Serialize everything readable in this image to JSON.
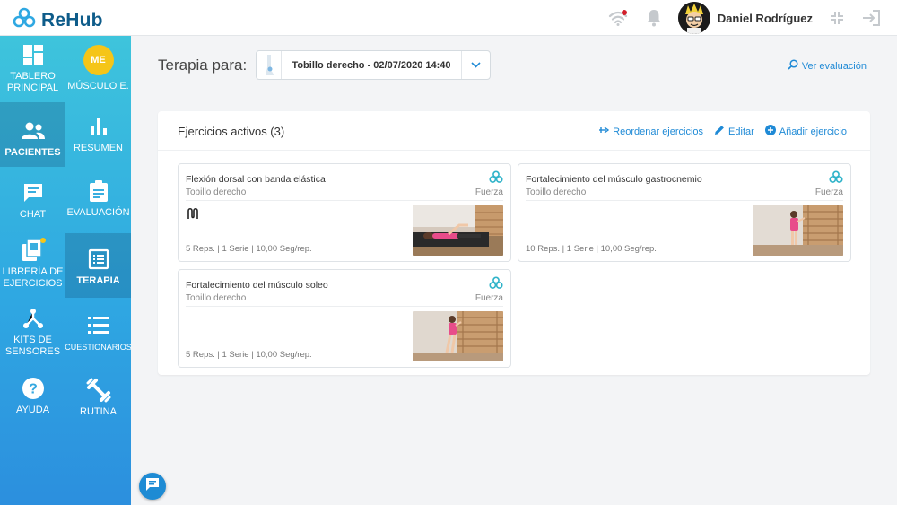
{
  "app": {
    "name": "ReHub"
  },
  "user": {
    "name": "Daniel Rodríguez"
  },
  "sidebar": {
    "col1": [
      {
        "label": "TABLERO PRINCIPAL",
        "icon": "dashboard-icon",
        "active": false
      },
      {
        "label": "PACIENTES",
        "icon": "users-icon",
        "active": true
      },
      {
        "label": "CHAT",
        "icon": "chat-icon",
        "active": false
      },
      {
        "label": "LIBRERÍA DE EJERCICIOS",
        "icon": "library-icon",
        "active": false
      },
      {
        "label": "KITS DE SENSORES",
        "icon": "sensors-icon",
        "active": false
      },
      {
        "label": "AYUDA",
        "icon": "help-icon",
        "active": false
      }
    ],
    "col2": [
      {
        "label": "MÚSCULO E.",
        "badge": "ME",
        "active": false
      },
      {
        "label": "RESUMEN",
        "icon": "bar-chart-icon",
        "active": false
      },
      {
        "label": "EVALUACIÓN",
        "icon": "clipboard-icon",
        "active": false
      },
      {
        "label": "TERAPIA",
        "icon": "list-doc-icon",
        "active": true
      },
      {
        "label": "CUESTIONARIOS",
        "icon": "checklist-icon",
        "active": false
      },
      {
        "label": "RUTINA",
        "icon": "dumbbell-icon",
        "active": false
      }
    ]
  },
  "header": {
    "label": "Terapia para:",
    "selected_therapy": "Tobillo derecho - 02/07/2020 14:40",
    "ver_evaluacion": "Ver evaluación"
  },
  "panel": {
    "title": "Ejercicios activos (3)",
    "actions": {
      "reorder": "Reordenar ejercicios",
      "edit": "Editar",
      "add": "Añadir ejercicio"
    }
  },
  "exercises": [
    {
      "title": "Flexión dorsal con banda elástica",
      "subtitle": "Tobillo derecho",
      "type": "Fuerza",
      "meta": "5 Reps. | 1 Serie | 10,00 Seg/rep."
    },
    {
      "title": "Fortalecimiento del músculo gastrocnemio",
      "subtitle": "Tobillo derecho",
      "type": "Fuerza",
      "meta": "10 Reps. | 1 Serie | 10,00 Seg/rep."
    },
    {
      "title": "Fortalecimiento del músculo soleo",
      "subtitle": "Tobillo derecho",
      "type": "Fuerza",
      "meta": "5 Reps. | 1 Serie | 10,00 Seg/rep."
    }
  ],
  "colors": {
    "accent": "#1f8ad6",
    "brand": "#0e5c8a",
    "sidebar_top": "#3ec4dc",
    "sidebar_bottom": "#2c8fde",
    "badge": "#f5c518"
  }
}
